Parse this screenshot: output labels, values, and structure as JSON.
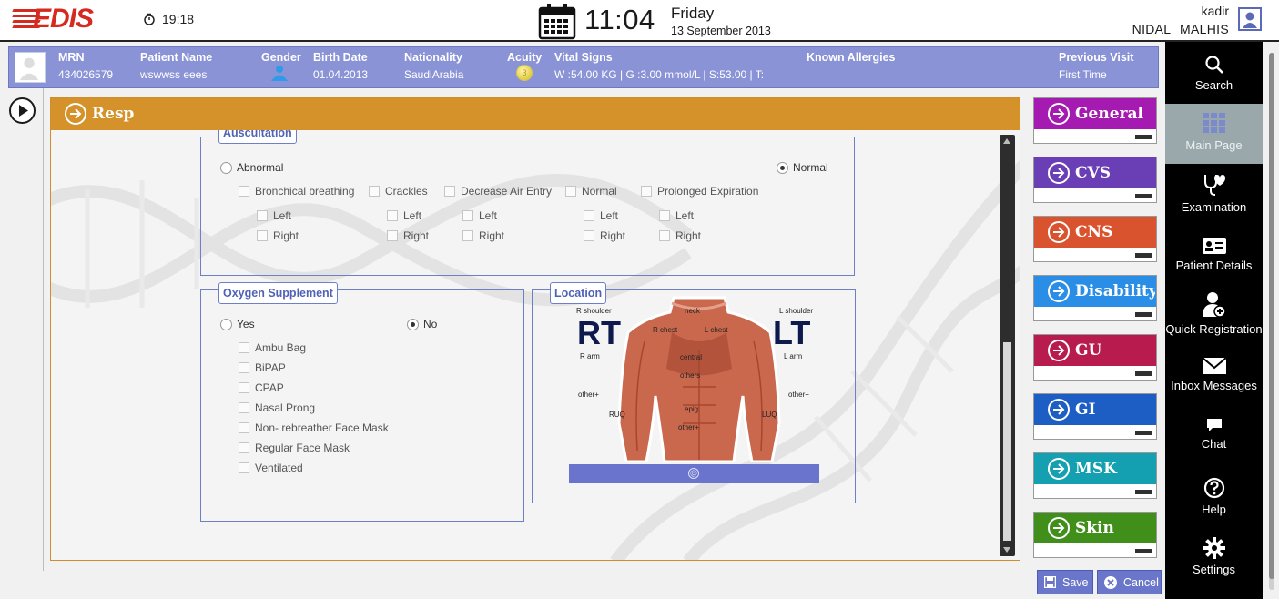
{
  "header": {
    "logo_text": "EDIS",
    "elapsed_time": "19:18",
    "clock_time": "11:04",
    "day": "Friday",
    "date": "13 September 2013",
    "user_login": "kadir",
    "user_fullname": "NIDAL  MALHIS"
  },
  "patient": {
    "mrn_label": "MRN",
    "mrn": "434026579",
    "name_label": "Patient Name",
    "name": "wswwss eees",
    "gender_label": "Gender",
    "birth_label": "Birth Date",
    "birth": "01.04.2013",
    "nationality_label": "Nationality",
    "nationality": "SaudiArabia",
    "acuity_label": "Acuity",
    "acuity": "3",
    "vitals_label": "Vital Signs",
    "vitals": "W :54.00 KG | G :3.00 mmol/L  |  S:53.00 |  T:",
    "allergies_label": "Known Allergies",
    "allergies": "",
    "prev_visit_label": "Previous Visit",
    "prev_visit": "First Time"
  },
  "section": {
    "title": "Resp"
  },
  "auscultation": {
    "legend": "Auscultation",
    "abnormal": "Abnormal",
    "normal": "Normal",
    "findings": [
      "Bronchical breathing",
      "Crackles",
      "Decrease Air Entry",
      "Normal",
      "Prolonged Expiration"
    ],
    "left": "Left",
    "right": "Right"
  },
  "oxygen": {
    "legend": "Oxygen Supplement",
    "yes": "Yes",
    "no": "No",
    "items": [
      "Ambu Bag",
      "BiPAP",
      "CPAP",
      "Nasal Prong",
      "Non- rebreather Face Mask",
      "Regular Face Mask",
      "Ventilated"
    ]
  },
  "location": {
    "legend": "Location",
    "rt": "RT",
    "lt": "LT",
    "labels": {
      "r_shoulder": "R shoulder",
      "neck": "neck",
      "l_shoulder": "L shoulder",
      "r_chest": "R chest",
      "l_chest": "L chest",
      "r_arm": "R arm",
      "l_arm": "L arm",
      "central": "central",
      "others": "others",
      "other_left": "other+",
      "other_right": "other+",
      "ruq": "RUQ",
      "luq": "LUQ",
      "epig": "epig",
      "other_bottom": "other+"
    }
  },
  "categories": [
    {
      "label": "General",
      "color": "#a51ab0"
    },
    {
      "label": "CVS",
      "color": "#6a3fb6"
    },
    {
      "label": "CNS",
      "color": "#d9532e"
    },
    {
      "label": "Disability",
      "color": "#2b8ee6"
    },
    {
      "label": "GU",
      "color": "#b81c4e"
    },
    {
      "label": "GI",
      "color": "#1c5ec4"
    },
    {
      "label": "MSK",
      "color": "#14a0b0"
    },
    {
      "label": "Skin",
      "color": "#3f8f1a"
    }
  ],
  "nav": {
    "search": "Search",
    "main_page": "Main Page",
    "examination": "Examination",
    "patient_details": "Patient Details",
    "quick_registration": "Quick Registration",
    "inbox": "Inbox Messages",
    "chat": "Chat",
    "help": "Help",
    "settings": "Settings"
  },
  "actions": {
    "save": "Save",
    "cancel": "Cancel"
  },
  "colors": {
    "banner": "#8a93d6",
    "section": "#d5922a",
    "accent": "#6a76c9"
  }
}
